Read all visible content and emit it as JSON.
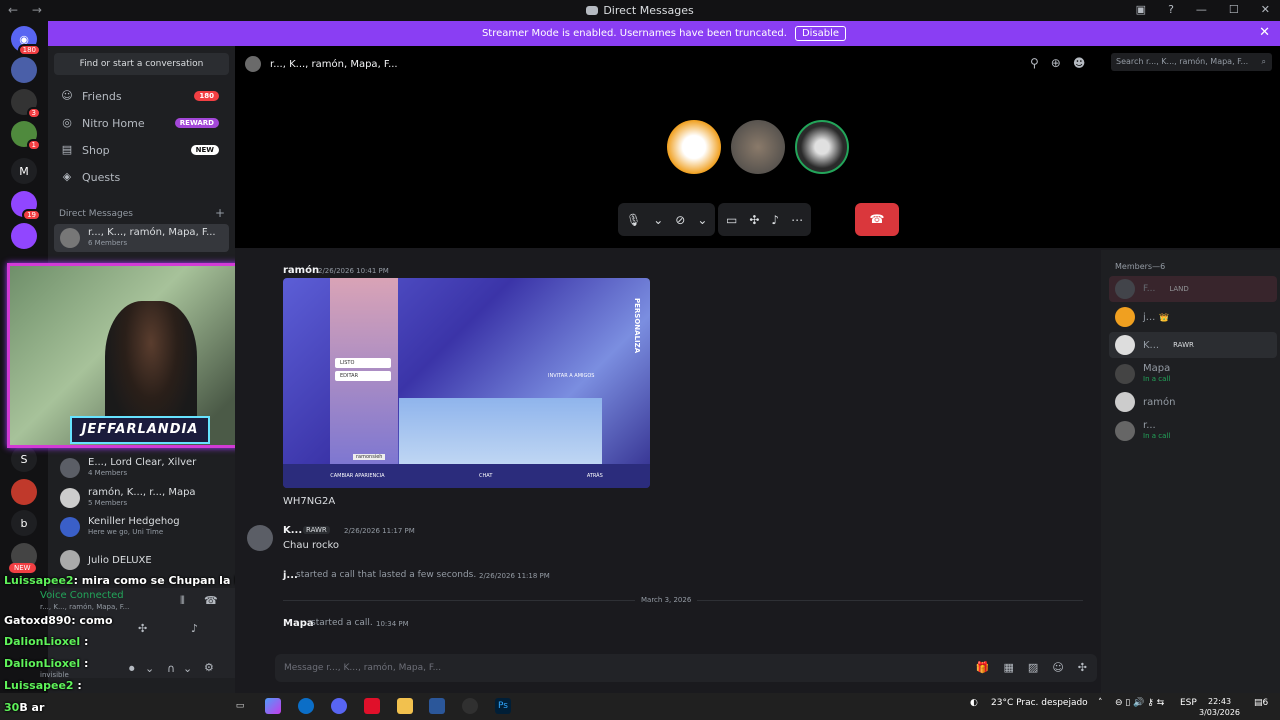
{
  "window": {
    "title": "Direct Messages",
    "back": "←",
    "forward": "→"
  },
  "banner": {
    "text": "Streamer Mode is enabled. Usernames have been truncated.",
    "button": "Disable",
    "close": "✕"
  },
  "rail": {
    "badges": [
      "180",
      "3",
      "1",
      "19"
    ],
    "letters": [
      "M",
      "S",
      "b"
    ],
    "new_label": "NEW"
  },
  "sidebar": {
    "search": "Find or start a conversation",
    "nav": [
      {
        "label": "Friends",
        "icon": "friends-icon",
        "pill": "180",
        "pill_color": "#f23f43"
      },
      {
        "label": "Nitro Home",
        "icon": "nitro-icon",
        "pill": "REWARD",
        "pill_color": "#a347d8"
      },
      {
        "label": "Shop",
        "icon": "shop-icon",
        "pill": "NEW",
        "pill_color": "#ffffff"
      },
      {
        "label": "Quests",
        "icon": "quests-icon",
        "pill": "",
        "pill_color": ""
      }
    ],
    "dm_header": "Direct Messages",
    "dms": [
      {
        "name": "r..., K..., ramón, Mapa, F...",
        "sub": "6 Members"
      },
      {
        "name": "E..., Lord Clear, Xilver",
        "sub": "4 Members"
      },
      {
        "name": "ramón, K..., r..., Mapa",
        "sub": "5 Members"
      },
      {
        "name": "Keniller Hedgehog",
        "sub": "Here we go, Uni Time"
      },
      {
        "name": "Julio DELUXE",
        "sub": ""
      }
    ]
  },
  "voice": {
    "status": "Voice Connected",
    "channel": "r..., K..., ramón, Mapa, F...",
    "user_status": "invisible"
  },
  "call": {
    "header": "r..., K..., ramón, Mapa, F...",
    "search_placeholder": "Search r..., K..., ramón, Mapa, F..."
  },
  "chat": {
    "msg1": {
      "author": "ramón",
      "time": "2/26/2026 10:41 PM",
      "text": "WH7NG2A"
    },
    "embed": {
      "btn1": "LISTO",
      "btn2": "EDITAR",
      "invite": "INVITAR A AMIGOS",
      "side": "PERSONALIZA",
      "bottom": [
        "CAMBIAR APARIENCIA",
        "CHAT",
        "ATRÁS"
      ],
      "nametag": "ramonsieh"
    },
    "msg2": {
      "author": "K...",
      "tag": "RAWR",
      "time": "2/26/2026 11:17 PM",
      "text": "Chau rocko"
    },
    "sys1": {
      "author": "j...",
      "text": "started a call that lasted a few seconds.",
      "time": "2/26/2026 11:18 PM"
    },
    "divider": "March 3, 2026",
    "sys2": {
      "author": "Mapa",
      "text": "started a call.",
      "time": "10:34 PM"
    },
    "input_placeholder": "Message r..., K..., ramón, Mapa, F..."
  },
  "members": {
    "header": "Members—6",
    "list": [
      {
        "name": "F...",
        "tag": "LAND",
        "sub": ""
      },
      {
        "name": "j...",
        "tag": "👑",
        "sub": ""
      },
      {
        "name": "K...",
        "tag": "RAWR",
        "sub": ""
      },
      {
        "name": "Mapa",
        "tag": "",
        "sub": "In a call"
      },
      {
        "name": "ramón",
        "tag": "",
        "sub": ""
      },
      {
        "name": "r...",
        "tag": "",
        "sub": "In a call"
      }
    ]
  },
  "overlay": {
    "webcam_logo": "JEFFARLANDIA",
    "chat": [
      {
        "user": "Luissapee2",
        "text": ": mira como se Chupan la Pinga"
      },
      {
        "user": "Gatoxd890",
        "text": ": como"
      },
      {
        "user": "DalionLioxel",
        "text": " :"
      },
      {
        "user": "DalionLioxel",
        "text": " :"
      },
      {
        "user": "Luissapee2",
        "text": " :"
      },
      {
        "user": "30",
        "text": "B   ar"
      }
    ]
  },
  "taskbar": {
    "weather": "23°C  Prac. despejado",
    "lang": "ESP",
    "time": "22:43",
    "date": "3/03/2026",
    "notif": "6"
  }
}
